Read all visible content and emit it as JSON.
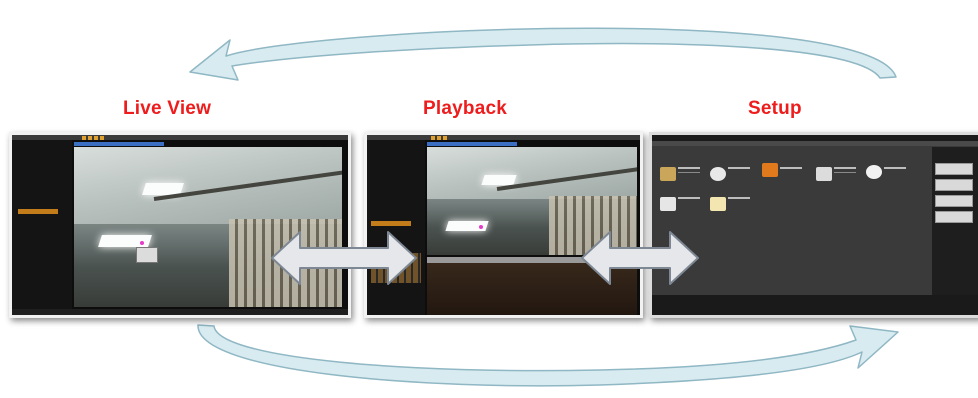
{
  "labels": {
    "live_view": "Live View",
    "playback": "Playback",
    "setup": "Setup"
  },
  "colors": {
    "label_red": "#ee1c1c",
    "arrow_fill": "#d8ebf0",
    "arrow_stroke": "#8fb7c4",
    "double_arrow_fill": "#e6e7ea",
    "ui_accent": "#c27d1a"
  },
  "icons": [
    "curved-arrow",
    "double-headed-arrow"
  ]
}
